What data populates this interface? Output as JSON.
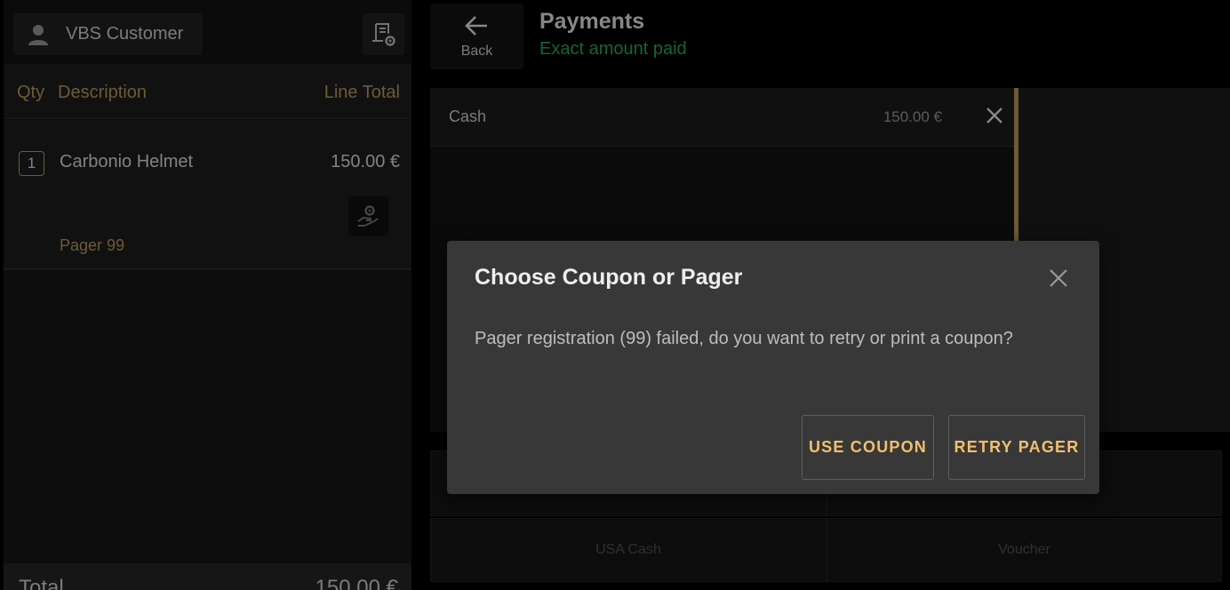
{
  "customer": {
    "label": "VBS Customer",
    "icon": "person-icon"
  },
  "receipt_action": {
    "icon": "receipt-settings-icon"
  },
  "columns": {
    "qty": "Qty",
    "description": "Description",
    "line_total": "Line Total"
  },
  "line_items": [
    {
      "qty": "1",
      "name": "Carbonio Helmet",
      "total": "150.00 €",
      "note": "Pager 99",
      "action_icon": "hand-gear-icon"
    }
  ],
  "footer": {
    "total_label": "Total",
    "total_value": "150.00 €"
  },
  "header": {
    "back_label": "Back",
    "back_icon": "arrow-left-icon",
    "title": "Payments",
    "status": "Exact amount paid"
  },
  "payments": [
    {
      "method": "Cash",
      "amount": "150.00 €",
      "remove_icon": "close-icon"
    }
  ],
  "tenders": [
    "",
    "",
    "USA Cash",
    "Voucher"
  ],
  "dialog": {
    "title": "Choose Coupon or Pager",
    "message": "Pager registration (99) failed, do you want to retry or print a coupon?",
    "buttons": {
      "coupon": "USE COUPON",
      "retry": "RETRY PAGER"
    },
    "close_icon": "close-icon"
  },
  "colors": {
    "accent": "#a88a55",
    "success": "#1f9d4c",
    "button_text": "#f0c070",
    "dialog_bg": "#383838"
  }
}
